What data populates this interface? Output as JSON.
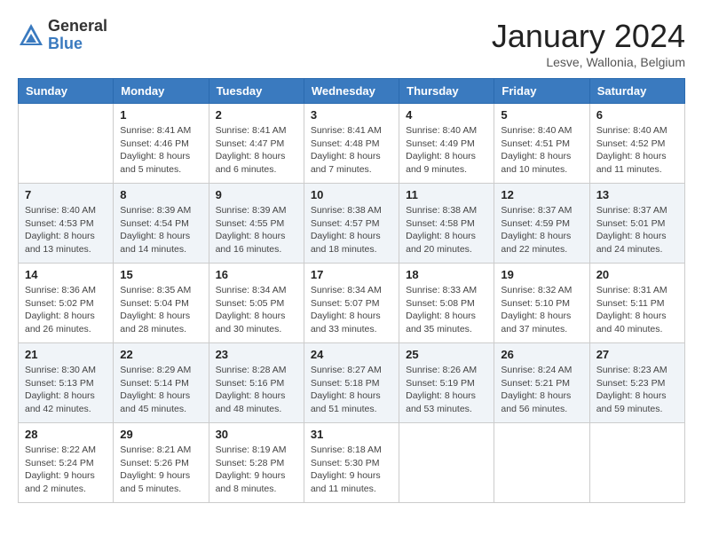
{
  "header": {
    "logo_general": "General",
    "logo_blue": "Blue",
    "month_title": "January 2024",
    "location": "Lesve, Wallonia, Belgium"
  },
  "days_of_week": [
    "Sunday",
    "Monday",
    "Tuesday",
    "Wednesday",
    "Thursday",
    "Friday",
    "Saturday"
  ],
  "weeks": [
    [
      {
        "day": "",
        "content": ""
      },
      {
        "day": "1",
        "content": "Sunrise: 8:41 AM\nSunset: 4:46 PM\nDaylight: 8 hours\nand 5 minutes."
      },
      {
        "day": "2",
        "content": "Sunrise: 8:41 AM\nSunset: 4:47 PM\nDaylight: 8 hours\nand 6 minutes."
      },
      {
        "day": "3",
        "content": "Sunrise: 8:41 AM\nSunset: 4:48 PM\nDaylight: 8 hours\nand 7 minutes."
      },
      {
        "day": "4",
        "content": "Sunrise: 8:40 AM\nSunset: 4:49 PM\nDaylight: 8 hours\nand 9 minutes."
      },
      {
        "day": "5",
        "content": "Sunrise: 8:40 AM\nSunset: 4:51 PM\nDaylight: 8 hours\nand 10 minutes."
      },
      {
        "day": "6",
        "content": "Sunrise: 8:40 AM\nSunset: 4:52 PM\nDaylight: 8 hours\nand 11 minutes."
      }
    ],
    [
      {
        "day": "7",
        "content": "Sunrise: 8:40 AM\nSunset: 4:53 PM\nDaylight: 8 hours\nand 13 minutes."
      },
      {
        "day": "8",
        "content": "Sunrise: 8:39 AM\nSunset: 4:54 PM\nDaylight: 8 hours\nand 14 minutes."
      },
      {
        "day": "9",
        "content": "Sunrise: 8:39 AM\nSunset: 4:55 PM\nDaylight: 8 hours\nand 16 minutes."
      },
      {
        "day": "10",
        "content": "Sunrise: 8:38 AM\nSunset: 4:57 PM\nDaylight: 8 hours\nand 18 minutes."
      },
      {
        "day": "11",
        "content": "Sunrise: 8:38 AM\nSunset: 4:58 PM\nDaylight: 8 hours\nand 20 minutes."
      },
      {
        "day": "12",
        "content": "Sunrise: 8:37 AM\nSunset: 4:59 PM\nDaylight: 8 hours\nand 22 minutes."
      },
      {
        "day": "13",
        "content": "Sunrise: 8:37 AM\nSunset: 5:01 PM\nDaylight: 8 hours\nand 24 minutes."
      }
    ],
    [
      {
        "day": "14",
        "content": "Sunrise: 8:36 AM\nSunset: 5:02 PM\nDaylight: 8 hours\nand 26 minutes."
      },
      {
        "day": "15",
        "content": "Sunrise: 8:35 AM\nSunset: 5:04 PM\nDaylight: 8 hours\nand 28 minutes."
      },
      {
        "day": "16",
        "content": "Sunrise: 8:34 AM\nSunset: 5:05 PM\nDaylight: 8 hours\nand 30 minutes."
      },
      {
        "day": "17",
        "content": "Sunrise: 8:34 AM\nSunset: 5:07 PM\nDaylight: 8 hours\nand 33 minutes."
      },
      {
        "day": "18",
        "content": "Sunrise: 8:33 AM\nSunset: 5:08 PM\nDaylight: 8 hours\nand 35 minutes."
      },
      {
        "day": "19",
        "content": "Sunrise: 8:32 AM\nSunset: 5:10 PM\nDaylight: 8 hours\nand 37 minutes."
      },
      {
        "day": "20",
        "content": "Sunrise: 8:31 AM\nSunset: 5:11 PM\nDaylight: 8 hours\nand 40 minutes."
      }
    ],
    [
      {
        "day": "21",
        "content": "Sunrise: 8:30 AM\nSunset: 5:13 PM\nDaylight: 8 hours\nand 42 minutes."
      },
      {
        "day": "22",
        "content": "Sunrise: 8:29 AM\nSunset: 5:14 PM\nDaylight: 8 hours\nand 45 minutes."
      },
      {
        "day": "23",
        "content": "Sunrise: 8:28 AM\nSunset: 5:16 PM\nDaylight: 8 hours\nand 48 minutes."
      },
      {
        "day": "24",
        "content": "Sunrise: 8:27 AM\nSunset: 5:18 PM\nDaylight: 8 hours\nand 51 minutes."
      },
      {
        "day": "25",
        "content": "Sunrise: 8:26 AM\nSunset: 5:19 PM\nDaylight: 8 hours\nand 53 minutes."
      },
      {
        "day": "26",
        "content": "Sunrise: 8:24 AM\nSunset: 5:21 PM\nDaylight: 8 hours\nand 56 minutes."
      },
      {
        "day": "27",
        "content": "Sunrise: 8:23 AM\nSunset: 5:23 PM\nDaylight: 8 hours\nand 59 minutes."
      }
    ],
    [
      {
        "day": "28",
        "content": "Sunrise: 8:22 AM\nSunset: 5:24 PM\nDaylight: 9 hours\nand 2 minutes."
      },
      {
        "day": "29",
        "content": "Sunrise: 8:21 AM\nSunset: 5:26 PM\nDaylight: 9 hours\nand 5 minutes."
      },
      {
        "day": "30",
        "content": "Sunrise: 8:19 AM\nSunset: 5:28 PM\nDaylight: 9 hours\nand 8 minutes."
      },
      {
        "day": "31",
        "content": "Sunrise: 8:18 AM\nSunset: 5:30 PM\nDaylight: 9 hours\nand 11 minutes."
      },
      {
        "day": "",
        "content": ""
      },
      {
        "day": "",
        "content": ""
      },
      {
        "day": "",
        "content": ""
      }
    ]
  ]
}
